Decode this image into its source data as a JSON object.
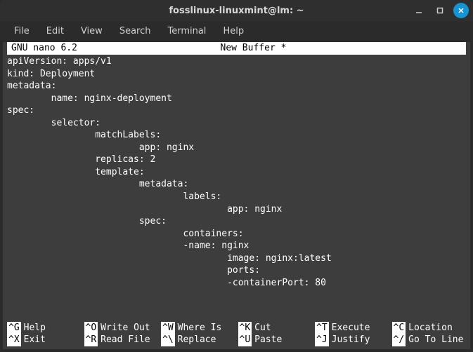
{
  "window": {
    "title": "fosslinux-linuxmint@lm: ~"
  },
  "menubar": [
    "File",
    "Edit",
    "View",
    "Search",
    "Terminal",
    "Help"
  ],
  "nano": {
    "app": "GNU nano 6.2",
    "buffer": "New Buffer *",
    "content": "apiVersion: apps/v1\nkind: Deployment\nmetadata:\n        name: nginx-deployment\nspec:\n        selector:\n                matchLabels:\n                        app: nginx\n                replicas: 2\n                template:\n                        metadata:\n                                labels:\n                                        app: nginx\n                        spec:\n                                containers:\n                                -name: nginx\n                                        image: nginx:latest\n                                        ports:\n                                        -containerPort: 80",
    "shortcuts": [
      {
        "key": "^G",
        "label": "Help"
      },
      {
        "key": "^O",
        "label": "Write Out"
      },
      {
        "key": "^W",
        "label": "Where Is"
      },
      {
        "key": "^K",
        "label": "Cut"
      },
      {
        "key": "^T",
        "label": "Execute"
      },
      {
        "key": "^C",
        "label": "Location"
      },
      {
        "key": "^X",
        "label": "Exit"
      },
      {
        "key": "^R",
        "label": "Read File"
      },
      {
        "key": "^\\",
        "label": "Replace"
      },
      {
        "key": "^U",
        "label": "Paste"
      },
      {
        "key": "^J",
        "label": "Justify"
      },
      {
        "key": "^/",
        "label": "Go To Line"
      }
    ]
  }
}
